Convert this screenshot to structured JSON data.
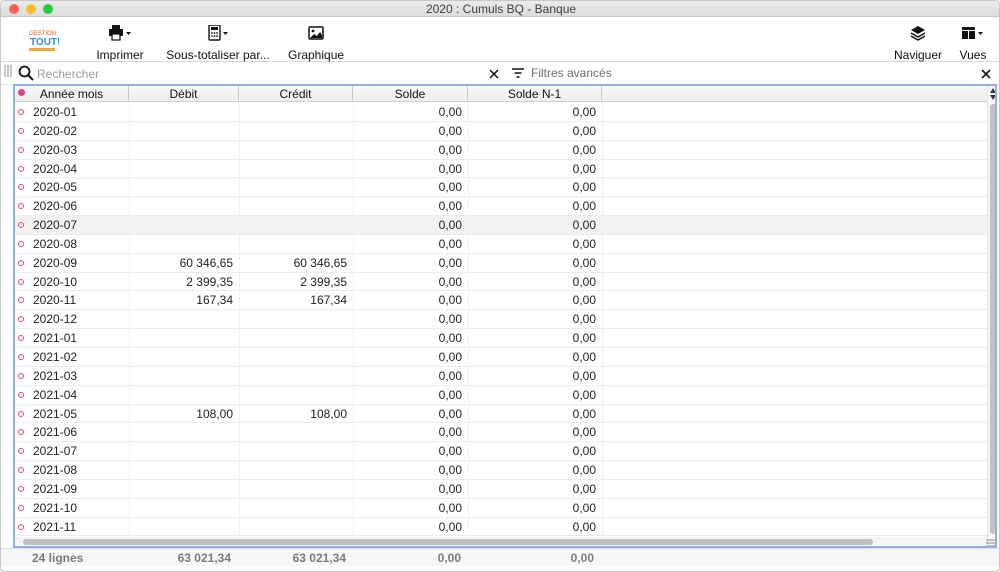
{
  "window": {
    "title": "2020 : Cumuls BQ - Banque",
    "traffic_colors": [
      "#fe5f57",
      "#febc2e",
      "#28c840"
    ]
  },
  "toolbar": {
    "logo_text": "GESTION TOUT!",
    "print_label": "Imprimer",
    "subtotal_label": "Sous-totaliser par...",
    "chart_label": "Graphique",
    "navigate_label": "Naviguer",
    "views_label": "Vues"
  },
  "search": {
    "placeholder": "Rechercher",
    "value": "",
    "filters_label": "Filtres avancés"
  },
  "table": {
    "columns": [
      "Année mois",
      "Débit",
      "Crédit",
      "Solde",
      "Solde N-1"
    ],
    "rows": [
      {
        "month": "2020-01",
        "debit": "",
        "credit": "",
        "solde": "0,00",
        "solde_n1": "0,00"
      },
      {
        "month": "2020-02",
        "debit": "",
        "credit": "",
        "solde": "0,00",
        "solde_n1": "0,00"
      },
      {
        "month": "2020-03",
        "debit": "",
        "credit": "",
        "solde": "0,00",
        "solde_n1": "0,00"
      },
      {
        "month": "2020-04",
        "debit": "",
        "credit": "",
        "solde": "0,00",
        "solde_n1": "0,00"
      },
      {
        "month": "2020-05",
        "debit": "",
        "credit": "",
        "solde": "0,00",
        "solde_n1": "0,00"
      },
      {
        "month": "2020-06",
        "debit": "",
        "credit": "",
        "solde": "0,00",
        "solde_n1": "0,00"
      },
      {
        "month": "2020-07",
        "debit": "",
        "credit": "",
        "solde": "0,00",
        "solde_n1": "0,00"
      },
      {
        "month": "2020-08",
        "debit": "",
        "credit": "",
        "solde": "0,00",
        "solde_n1": "0,00"
      },
      {
        "month": "2020-09",
        "debit": "60 346,65",
        "credit": "60 346,65",
        "solde": "0,00",
        "solde_n1": "0,00"
      },
      {
        "month": "2020-10",
        "debit": "2 399,35",
        "credit": "2 399,35",
        "solde": "0,00",
        "solde_n1": "0,00"
      },
      {
        "month": "2020-11",
        "debit": "167,34",
        "credit": "167,34",
        "solde": "0,00",
        "solde_n1": "0,00"
      },
      {
        "month": "2020-12",
        "debit": "",
        "credit": "",
        "solde": "0,00",
        "solde_n1": "0,00"
      },
      {
        "month": "2021-01",
        "debit": "",
        "credit": "",
        "solde": "0,00",
        "solde_n1": "0,00"
      },
      {
        "month": "2021-02",
        "debit": "",
        "credit": "",
        "solde": "0,00",
        "solde_n1": "0,00"
      },
      {
        "month": "2021-03",
        "debit": "",
        "credit": "",
        "solde": "0,00",
        "solde_n1": "0,00"
      },
      {
        "month": "2021-04",
        "debit": "",
        "credit": "",
        "solde": "0,00",
        "solde_n1": "0,00"
      },
      {
        "month": "2021-05",
        "debit": "108,00",
        "credit": "108,00",
        "solde": "0,00",
        "solde_n1": "0,00"
      },
      {
        "month": "2021-06",
        "debit": "",
        "credit": "",
        "solde": "0,00",
        "solde_n1": "0,00"
      },
      {
        "month": "2021-07",
        "debit": "",
        "credit": "",
        "solde": "0,00",
        "solde_n1": "0,00"
      },
      {
        "month": "2021-08",
        "debit": "",
        "credit": "",
        "solde": "0,00",
        "solde_n1": "0,00"
      },
      {
        "month": "2021-09",
        "debit": "",
        "credit": "",
        "solde": "0,00",
        "solde_n1": "0,00"
      },
      {
        "month": "2021-10",
        "debit": "",
        "credit": "",
        "solde": "0,00",
        "solde_n1": "0,00"
      },
      {
        "month": "2021-11",
        "debit": "",
        "credit": "",
        "solde": "0,00",
        "solde_n1": "0,00"
      }
    ],
    "selected_row": 6
  },
  "footer": {
    "count": "24 lignes",
    "debit_total": "63 021,34",
    "credit_total": "63 021,34",
    "solde_total": "0,00",
    "solde_n1_total": "0,00"
  },
  "colors": {
    "accent_border": "#8fb2e6",
    "row_marker": "#e0457b",
    "header_marker": "#e0457b"
  },
  "icons": [
    "printer-icon",
    "calculator-icon",
    "image-icon",
    "layers-icon",
    "layout-icon",
    "search-icon",
    "clear-icon",
    "filter-icon",
    "close-icon"
  ]
}
